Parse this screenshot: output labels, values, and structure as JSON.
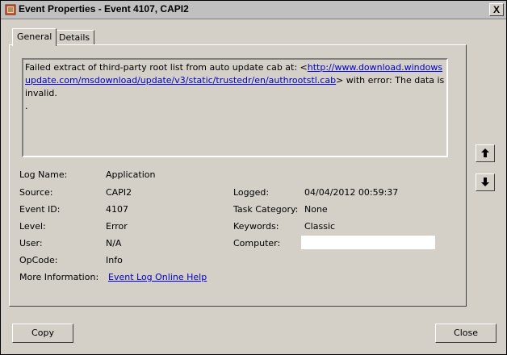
{
  "window": {
    "title": "Event Properties - Event 4107, CAPI2",
    "close_glyph": "X"
  },
  "tabs": [
    {
      "label": "General"
    },
    {
      "label": "Details"
    }
  ],
  "description": {
    "prefix": "Failed extract of third-party root list from auto update cab at: <",
    "url": "http://www.download.windowsupdate.com/msdownload/update/v3/static/trustedr/en/authrootstl.cab",
    "suffix": "> with error: The data is invalid.",
    "trailing": "."
  },
  "fields": {
    "log_name": {
      "label": "Log Name:",
      "value": "Application"
    },
    "source": {
      "label": "Source:",
      "value": "CAPI2"
    },
    "logged": {
      "label": "Logged:",
      "value": "04/04/2012 00:59:37"
    },
    "event_id": {
      "label": "Event ID:",
      "value": "4107"
    },
    "task_category": {
      "label": "Task Category:",
      "value": "None"
    },
    "level": {
      "label": "Level:",
      "value": "Error"
    },
    "keywords": {
      "label": "Keywords:",
      "value": "Classic"
    },
    "user": {
      "label": "User:",
      "value": "N/A"
    },
    "computer": {
      "label": "Computer:",
      "value": ""
    },
    "opcode": {
      "label": "OpCode:",
      "value": "Info"
    },
    "more_info": {
      "label": "More Information:",
      "link": "Event Log Online Help"
    }
  },
  "buttons": {
    "copy": "Copy",
    "close": "Close"
  }
}
